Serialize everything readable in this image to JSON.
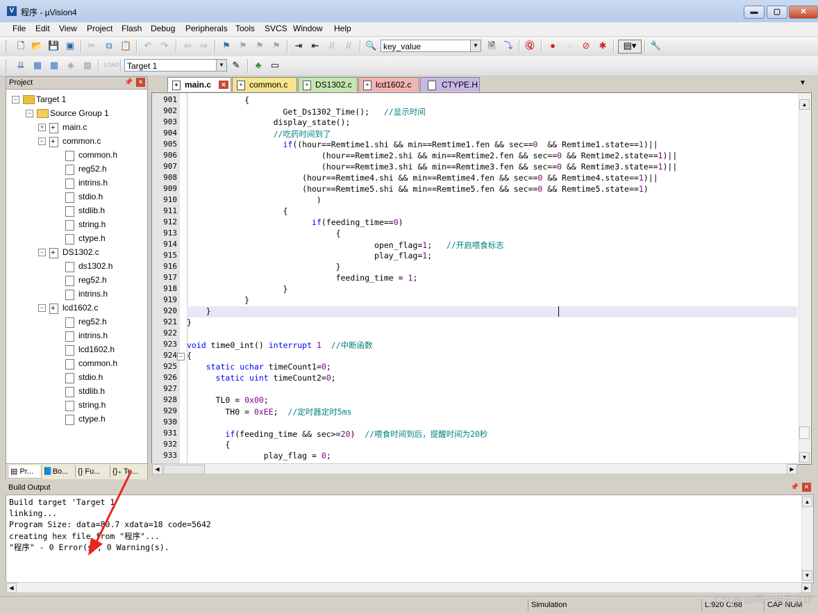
{
  "window": {
    "title": "程序 - µVision4",
    "app_icon": "uvision-icon",
    "controls": {
      "minimize": "▬",
      "maximize": "▢",
      "close": "✕"
    }
  },
  "menu": [
    "File",
    "Edit",
    "View",
    "Project",
    "Flash",
    "Debug",
    "Peripherals",
    "Tools",
    "SVCS",
    "Window",
    "Help"
  ],
  "toolbar": {
    "find_combo": "key_value",
    "target_combo": "Target 1"
  },
  "project": {
    "panel_title": "Project",
    "tree": [
      {
        "label": "Target 1",
        "level": 0,
        "type": "target"
      },
      {
        "label": "Source Group 1",
        "level": 1,
        "type": "folder"
      },
      {
        "label": "main.c",
        "level": 2,
        "type": "cfile"
      },
      {
        "label": "common.c",
        "level": 2,
        "type": "cfile"
      },
      {
        "label": "common.h",
        "level": 3,
        "type": "hfile"
      },
      {
        "label": "reg52.h",
        "level": 3,
        "type": "hfile"
      },
      {
        "label": "intrins.h",
        "level": 3,
        "type": "hfile"
      },
      {
        "label": "stdio.h",
        "level": 3,
        "type": "hfile"
      },
      {
        "label": "stdlib.h",
        "level": 3,
        "type": "hfile"
      },
      {
        "label": "string.h",
        "level": 3,
        "type": "hfile"
      },
      {
        "label": "ctype.h",
        "level": 3,
        "type": "hfile"
      },
      {
        "label": "DS1302.c",
        "level": 2,
        "type": "cfile"
      },
      {
        "label": "ds1302.h",
        "level": 3,
        "type": "hfile"
      },
      {
        "label": "reg52.h",
        "level": 3,
        "type": "hfile"
      },
      {
        "label": "intrins.h",
        "level": 3,
        "type": "hfile"
      },
      {
        "label": "lcd1602.c",
        "level": 2,
        "type": "cfile"
      },
      {
        "label": "reg52.h",
        "level": 3,
        "type": "hfile"
      },
      {
        "label": "intrins.h",
        "level": 3,
        "type": "hfile"
      },
      {
        "label": "lcd1602.h",
        "level": 3,
        "type": "hfile"
      },
      {
        "label": "common.h",
        "level": 3,
        "type": "hfile"
      },
      {
        "label": "stdio.h",
        "level": 3,
        "type": "hfile"
      },
      {
        "label": "stdlib.h",
        "level": 3,
        "type": "hfile"
      },
      {
        "label": "string.h",
        "level": 3,
        "type": "hfile"
      },
      {
        "label": "ctype.h",
        "level": 3,
        "type": "hfile"
      }
    ],
    "tabs": [
      "Pr...",
      "Bo...",
      "{} Fu...",
      "{}₊ Te..."
    ]
  },
  "editor": {
    "tabs": [
      {
        "label": "main.c",
        "color": "#ffffff",
        "active": true
      },
      {
        "label": "common.c",
        "color": "#f5e58c"
      },
      {
        "label": "DS1302.c",
        "color": "#c6e6b0"
      },
      {
        "label": "lcd1602.c",
        "color": "#f2b3b3"
      },
      {
        "label": "CTYPE.H",
        "color": "#c9b6e6"
      }
    ],
    "lines": [
      {
        "n": "901",
        "code": [
          [
            "            {",
            ""
          ]
        ]
      },
      {
        "n": "902",
        "code": [
          [
            "                    Get_Ds1302_Time();   ",
            ""
          ],
          [
            "//显示时间",
            "cm"
          ]
        ]
      },
      {
        "n": "903",
        "code": [
          [
            "                  display_state();",
            ""
          ]
        ]
      },
      {
        "n": "904",
        "code": [
          [
            "                  ",
            "cm"
          ],
          [
            "//吃药时间到了",
            "cm"
          ]
        ]
      },
      {
        "n": "905",
        "code": [
          [
            "                    ",
            ""
          ],
          [
            "if",
            "kw"
          ],
          [
            "((hour==Remtime1.shi && min==Remtime1.fen && sec==",
            ""
          ],
          [
            "0",
            "num"
          ],
          [
            "  && Remtime1.state==",
            ""
          ],
          [
            "1",
            "num"
          ],
          [
            ")||",
            ""
          ]
        ]
      },
      {
        "n": "906",
        "code": [
          [
            "                            (hour==Remtime2.shi && min==Remtime2.fen && sec==",
            ""
          ],
          [
            "0",
            "num"
          ],
          [
            " && Remtime2.state==",
            ""
          ],
          [
            "1",
            "num"
          ],
          [
            ")||",
            ""
          ]
        ]
      },
      {
        "n": "907",
        "code": [
          [
            "                            (hour==Remtime3.shi && min==Remtime3.fen && sec==",
            ""
          ],
          [
            "0",
            "num"
          ],
          [
            " && Remtime3.state==",
            ""
          ],
          [
            "1",
            "num"
          ],
          [
            ")||",
            ""
          ]
        ]
      },
      {
        "n": "908",
        "code": [
          [
            "                        (hour==Remtime4.shi && min==Remtime4.fen && sec==",
            ""
          ],
          [
            "0",
            "num"
          ],
          [
            " && Remtime4.state==",
            ""
          ],
          [
            "1",
            "num"
          ],
          [
            ")||",
            ""
          ]
        ]
      },
      {
        "n": "909",
        "code": [
          [
            "                        (hour==Remtime5.shi && min==Remtime5.fen && sec==",
            ""
          ],
          [
            "0",
            "num"
          ],
          [
            " && Remtime5.state==",
            ""
          ],
          [
            "1",
            "num"
          ],
          [
            ")",
            ""
          ]
        ]
      },
      {
        "n": "910",
        "code": [
          [
            "                           )",
            ""
          ]
        ]
      },
      {
        "n": "911",
        "code": [
          [
            "                    {",
            ""
          ]
        ]
      },
      {
        "n": "912",
        "code": [
          [
            "                          ",
            ""
          ],
          [
            "if",
            "kw"
          ],
          [
            "(feeding_time==",
            ""
          ],
          [
            "0",
            "num"
          ],
          [
            ")",
            ""
          ]
        ]
      },
      {
        "n": "913",
        "code": [
          [
            "                               {",
            ""
          ]
        ]
      },
      {
        "n": "914",
        "code": [
          [
            "                                       open_flag=",
            ""
          ],
          [
            "1",
            "num"
          ],
          [
            ";   ",
            ""
          ],
          [
            "//开启喂食标志",
            "cm"
          ]
        ]
      },
      {
        "n": "915",
        "code": [
          [
            "                                       play_flag=",
            ""
          ],
          [
            "1",
            "num"
          ],
          [
            ";",
            ""
          ]
        ]
      },
      {
        "n": "916",
        "code": [
          [
            "                               }",
            ""
          ]
        ]
      },
      {
        "n": "917",
        "code": [
          [
            "                               feeding_time = ",
            ""
          ],
          [
            "1",
            "num"
          ],
          [
            ";",
            ""
          ]
        ]
      },
      {
        "n": "918",
        "code": [
          [
            "                    }",
            ""
          ]
        ]
      },
      {
        "n": "919",
        "code": [
          [
            "            }",
            ""
          ]
        ]
      },
      {
        "n": "920",
        "code": [
          [
            "    }",
            ""
          ]
        ]
      },
      {
        "n": "921",
        "code": [
          [
            "}",
            ""
          ]
        ]
      },
      {
        "n": "922",
        "code": [
          [
            "",
            ""
          ]
        ]
      },
      {
        "n": "923",
        "code": [
          [
            "void",
            "kw"
          ],
          [
            " time0_int() ",
            ""
          ],
          [
            "interrupt",
            "kw"
          ],
          [
            " ",
            ""
          ],
          [
            "1",
            "num"
          ],
          [
            "  ",
            ""
          ],
          [
            "//中断函数",
            "cm"
          ]
        ]
      },
      {
        "n": "924",
        "code": [
          [
            "{",
            ""
          ]
        ]
      },
      {
        "n": "925",
        "code": [
          [
            "    ",
            ""
          ],
          [
            "static",
            "kw"
          ],
          [
            " ",
            ""
          ],
          [
            "uchar",
            "kw"
          ],
          [
            " timeCount1=",
            ""
          ],
          [
            "0",
            "num"
          ],
          [
            ";",
            ""
          ]
        ]
      },
      {
        "n": "926",
        "code": [
          [
            "      ",
            ""
          ],
          [
            "static",
            "kw"
          ],
          [
            " ",
            ""
          ],
          [
            "uint",
            "kw"
          ],
          [
            " timeCount2=",
            ""
          ],
          [
            "0",
            "num"
          ],
          [
            ";",
            ""
          ]
        ]
      },
      {
        "n": "927",
        "code": [
          [
            "",
            ""
          ]
        ]
      },
      {
        "n": "928",
        "code": [
          [
            "      TL0 = ",
            ""
          ],
          [
            "0x00",
            "num"
          ],
          [
            ";",
            ""
          ]
        ]
      },
      {
        "n": "929",
        "code": [
          [
            "        TH0 = ",
            ""
          ],
          [
            "0xEE",
            "num"
          ],
          [
            ";  ",
            ""
          ],
          [
            "//定时器定时5ms",
            "cm"
          ]
        ]
      },
      {
        "n": "930",
        "code": [
          [
            "",
            ""
          ]
        ]
      },
      {
        "n": "931",
        "code": [
          [
            "        ",
            ""
          ],
          [
            "if",
            "kw"
          ],
          [
            "(feeding_time && sec>=",
            ""
          ],
          [
            "20",
            "num"
          ],
          [
            ")  ",
            ""
          ],
          [
            "//喂食时间到后，提醒时间为20秒",
            "cm"
          ]
        ]
      },
      {
        "n": "932",
        "code": [
          [
            "        {",
            ""
          ]
        ]
      },
      {
        "n": "933",
        "code": [
          [
            "                play_flag = ",
            ""
          ],
          [
            "0",
            "num"
          ],
          [
            ";",
            ""
          ]
        ]
      }
    ]
  },
  "build": {
    "title": "Build Output",
    "lines": [
      "Build target 'Target 1'",
      "linking...",
      "Program Size: data=80.7 xdata=18 code=5642",
      "creating hex file from \"程序\"...",
      "\"程序\" - 0 Error(s), 0 Warning(s)."
    ]
  },
  "status": {
    "mode": "Simulation",
    "position": "L:920 C:68",
    "caps": "CAP NUM"
  },
  "watermark": "CSDN @同一电子设计",
  "annotation": {
    "color": "#e8261a",
    "type": "arrow"
  }
}
